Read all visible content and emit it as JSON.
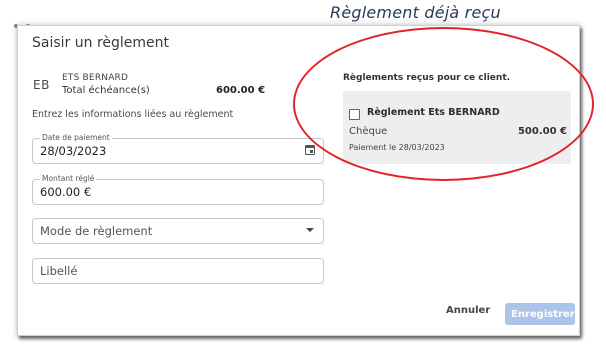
{
  "annotation": {
    "title": "Règlement déjà reçu"
  },
  "dialog": {
    "title": "Saisir un règlement",
    "client": {
      "avatar": "EB",
      "name": "ETS BERNARD",
      "echeance_label": "Total échéance(s)",
      "echeance_amount": "600.00 €"
    },
    "hint": "Entrez les informations liées au règlement",
    "fields": {
      "date": {
        "label": "Date de paiement",
        "value": "28/03/2023"
      },
      "amount": {
        "label": "Montant réglé",
        "value": "600.00 €"
      },
      "mode": {
        "placeholder": "Mode de règlement"
      },
      "libelle": {
        "placeholder": "Libellé"
      }
    },
    "received": {
      "header": "Règlements reçus pour ce client.",
      "card": {
        "title": "Règlement Ets BERNARD",
        "mode": "Chèque",
        "amount": "500.00 €",
        "date": "Paiement le 28/03/2023"
      }
    },
    "buttons": {
      "cancel": "Annuler",
      "save": "Enregistrer"
    }
  },
  "colors": {
    "highlight": "#e0252b",
    "save_button_bg": "#aac4ea",
    "card_bg": "#eeeeee",
    "annotation_text": "#2b3a55"
  }
}
